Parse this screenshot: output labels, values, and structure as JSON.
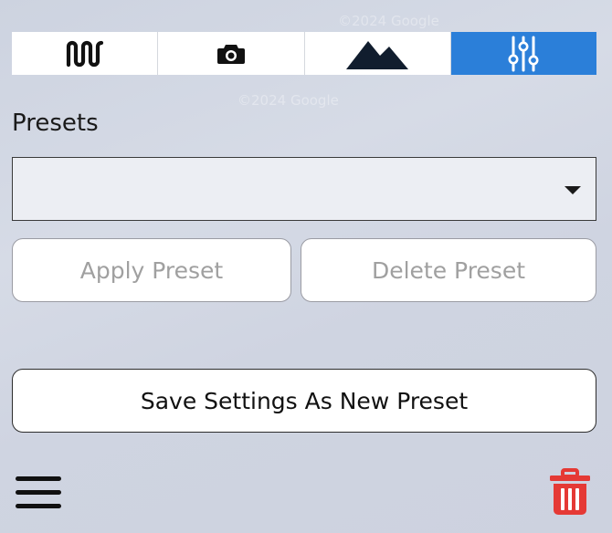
{
  "tabs": [
    {
      "name": "waveform",
      "icon": "waveform-icon",
      "active": false
    },
    {
      "name": "camera",
      "icon": "camera-icon",
      "active": false
    },
    {
      "name": "terrain",
      "icon": "mountain-icon",
      "active": false
    },
    {
      "name": "settings",
      "icon": "sliders-icon",
      "active": true
    }
  ],
  "presets": {
    "label": "Presets",
    "selected_value": "",
    "apply_label": "Apply Preset",
    "delete_label": "Delete Preset",
    "save_label": "Save Settings As New Preset"
  },
  "footer": {
    "menu_icon": "hamburger-menu-icon",
    "trash_icon": "trash-icon"
  },
  "colors": {
    "accent": "#2b7fd9",
    "danger": "#e53935",
    "background": "#d3d8e3"
  }
}
